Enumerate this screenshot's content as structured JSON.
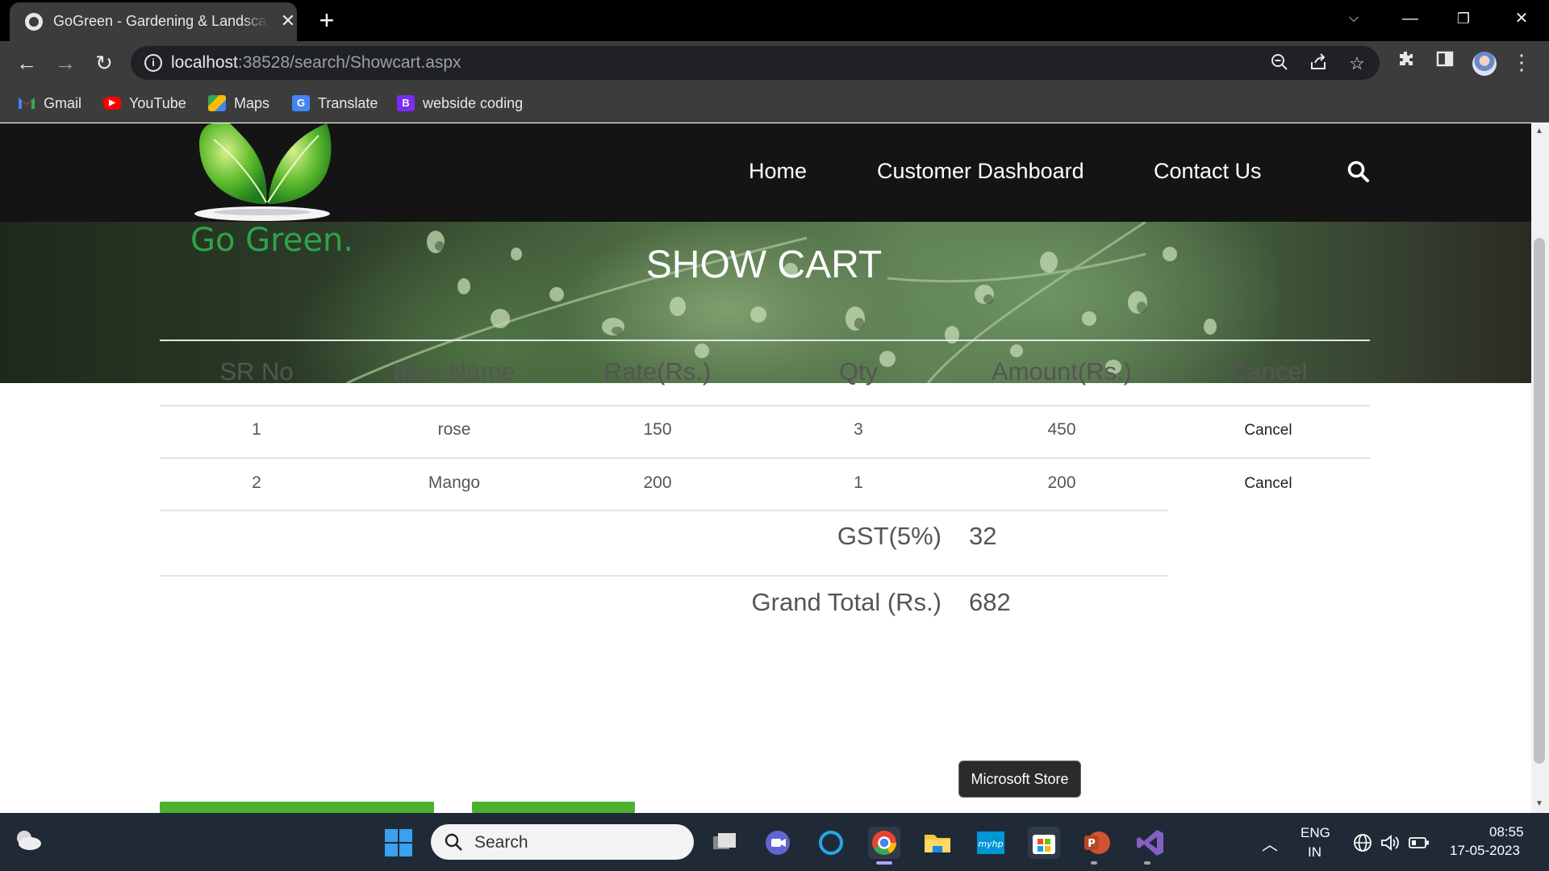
{
  "browser": {
    "tab_title": "GoGreen - Gardening & Landscaping",
    "url_host": "localhost",
    "url_rest": ":38528/search/Showcart.aspx",
    "bookmarks": [
      "Gmail",
      "YouTube",
      "Maps",
      "Translate",
      "webside coding"
    ],
    "bookmark_icon_letter": "B"
  },
  "site": {
    "logo_text": "Go Green.",
    "nav": [
      "Home",
      "Customer Dashboard",
      "Contact Us"
    ],
    "banner_title": "SHOW CART"
  },
  "cart": {
    "headers": [
      "SR No",
      "Item Name",
      "Rate(Rs.)",
      "Qty",
      "Amount(Rs.)",
      "Cancel"
    ],
    "rows": [
      {
        "sr": "1",
        "item": "rose",
        "rate": "150",
        "qty": "3",
        "amount": "450",
        "action": "Cancel"
      },
      {
        "sr": "2",
        "item": "Mango",
        "rate": "200",
        "qty": "1",
        "amount": "200",
        "action": "Cancel"
      }
    ],
    "gst_label": "GST(5%)",
    "gst_value": "32",
    "grand_total_label": "Grand Total (Rs.)",
    "grand_total_value": "682"
  },
  "tooltip": "Microsoft Store",
  "taskbar": {
    "search_placeholder": "Search",
    "lang_top": "ENG",
    "lang_bottom": "IN",
    "time": "08:55",
    "date": "17-05-2023"
  },
  "colors": {
    "brand_green": "#2ea34a",
    "button_green": "#4caf2f",
    "header_bg": "#141414"
  }
}
